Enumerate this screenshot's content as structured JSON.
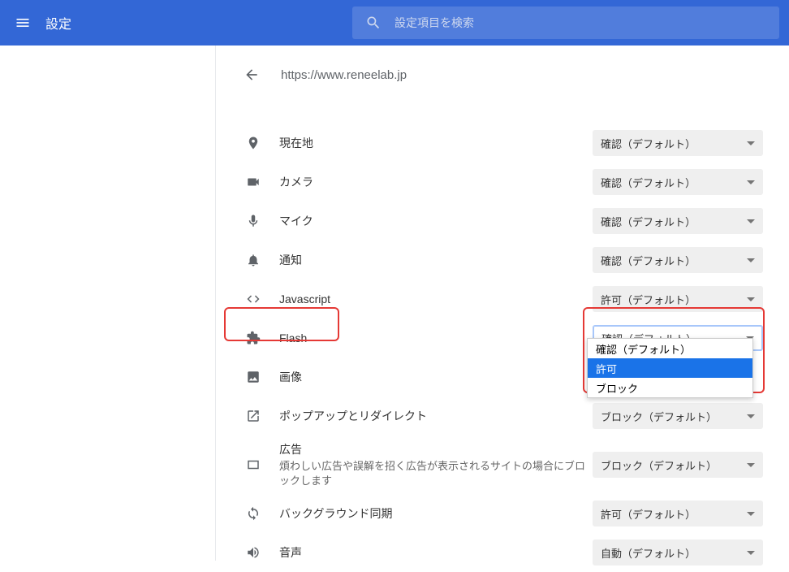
{
  "header": {
    "title": "設定"
  },
  "search": {
    "placeholder": "設定項目を検索"
  },
  "page": {
    "url": "https://www.reneelab.jp"
  },
  "rows": {
    "location": {
      "label": "現在地",
      "value": "確認（デフォルト）"
    },
    "camera": {
      "label": "カメラ",
      "value": "確認（デフォルト）"
    },
    "mic": {
      "label": "マイク",
      "value": "確認（デフォルト）"
    },
    "notify": {
      "label": "通知",
      "value": "確認（デフォルト）"
    },
    "js": {
      "label": "Javascript",
      "value": "許可（デフォルト）"
    },
    "flash": {
      "label": "Flash",
      "value": "確認（デフォルト）"
    },
    "image": {
      "label": "画像"
    },
    "popup": {
      "label": "ポップアップとリダイレクト",
      "value": "ブロック（デフォルト）"
    },
    "ads": {
      "label": "広告",
      "sub": "煩わしい広告や誤解を招く広告が表示されるサイトの場合にブロックします",
      "value": "ブロック（デフォルト）"
    },
    "bgsync": {
      "label": "バックグラウンド同期",
      "value": "許可（デフォルト）"
    },
    "sound": {
      "label": "音声",
      "value": "自動（デフォルト）"
    }
  },
  "flash_menu": {
    "opt1": "確認（デフォルト）",
    "opt2": "許可",
    "opt3": "ブロック"
  }
}
